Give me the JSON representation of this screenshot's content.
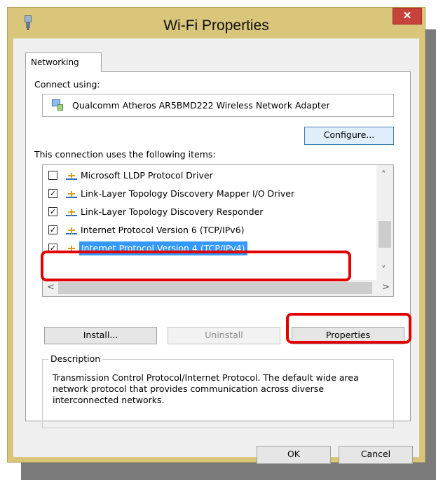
{
  "window": {
    "title": "Wi-Fi Properties",
    "close_glyph": "✕"
  },
  "tabs": [
    {
      "label": "Networking",
      "selected": true
    }
  ],
  "connect_using": {
    "label": "Connect using:",
    "adapter_name": "Qualcomm Atheros AR5BMD222 Wireless Network Adapter",
    "adapter_icon": "network-adapter-icon"
  },
  "buttons": {
    "configure": "Configure...",
    "install": "Install...",
    "uninstall": "Uninstall",
    "properties": "Properties",
    "ok": "OK",
    "cancel": "Cancel"
  },
  "items_label": "This connection uses the following items:",
  "items": [
    {
      "label": "Microsoft LLDP Protocol Driver",
      "checked": false,
      "check": ""
    },
    {
      "label": "Link-Layer Topology Discovery Mapper I/O Driver",
      "checked": true,
      "check": "✓"
    },
    {
      "label": "Link-Layer Topology Discovery Responder",
      "checked": true,
      "check": "✓"
    },
    {
      "label": "Internet Protocol Version 6 (TCP/IPv6)",
      "checked": true,
      "check": "✓"
    },
    {
      "label": "Internet Protocol Version 4 (TCP/IPv4)",
      "checked": true,
      "check": "✓",
      "selected": true
    }
  ],
  "scroll": {
    "up": "˄",
    "down": "˅",
    "left": "<",
    "right": ">"
  },
  "description": {
    "title": "Description",
    "text": "Transmission Control Protocol/Internet Protocol. The default wide area network protocol that provides communication across diverse interconnected networks."
  },
  "colors": {
    "title_bar": "#d9c67b",
    "close_button": "#c8423c",
    "selection": "#3399ff",
    "annotation": "#e00000"
  }
}
